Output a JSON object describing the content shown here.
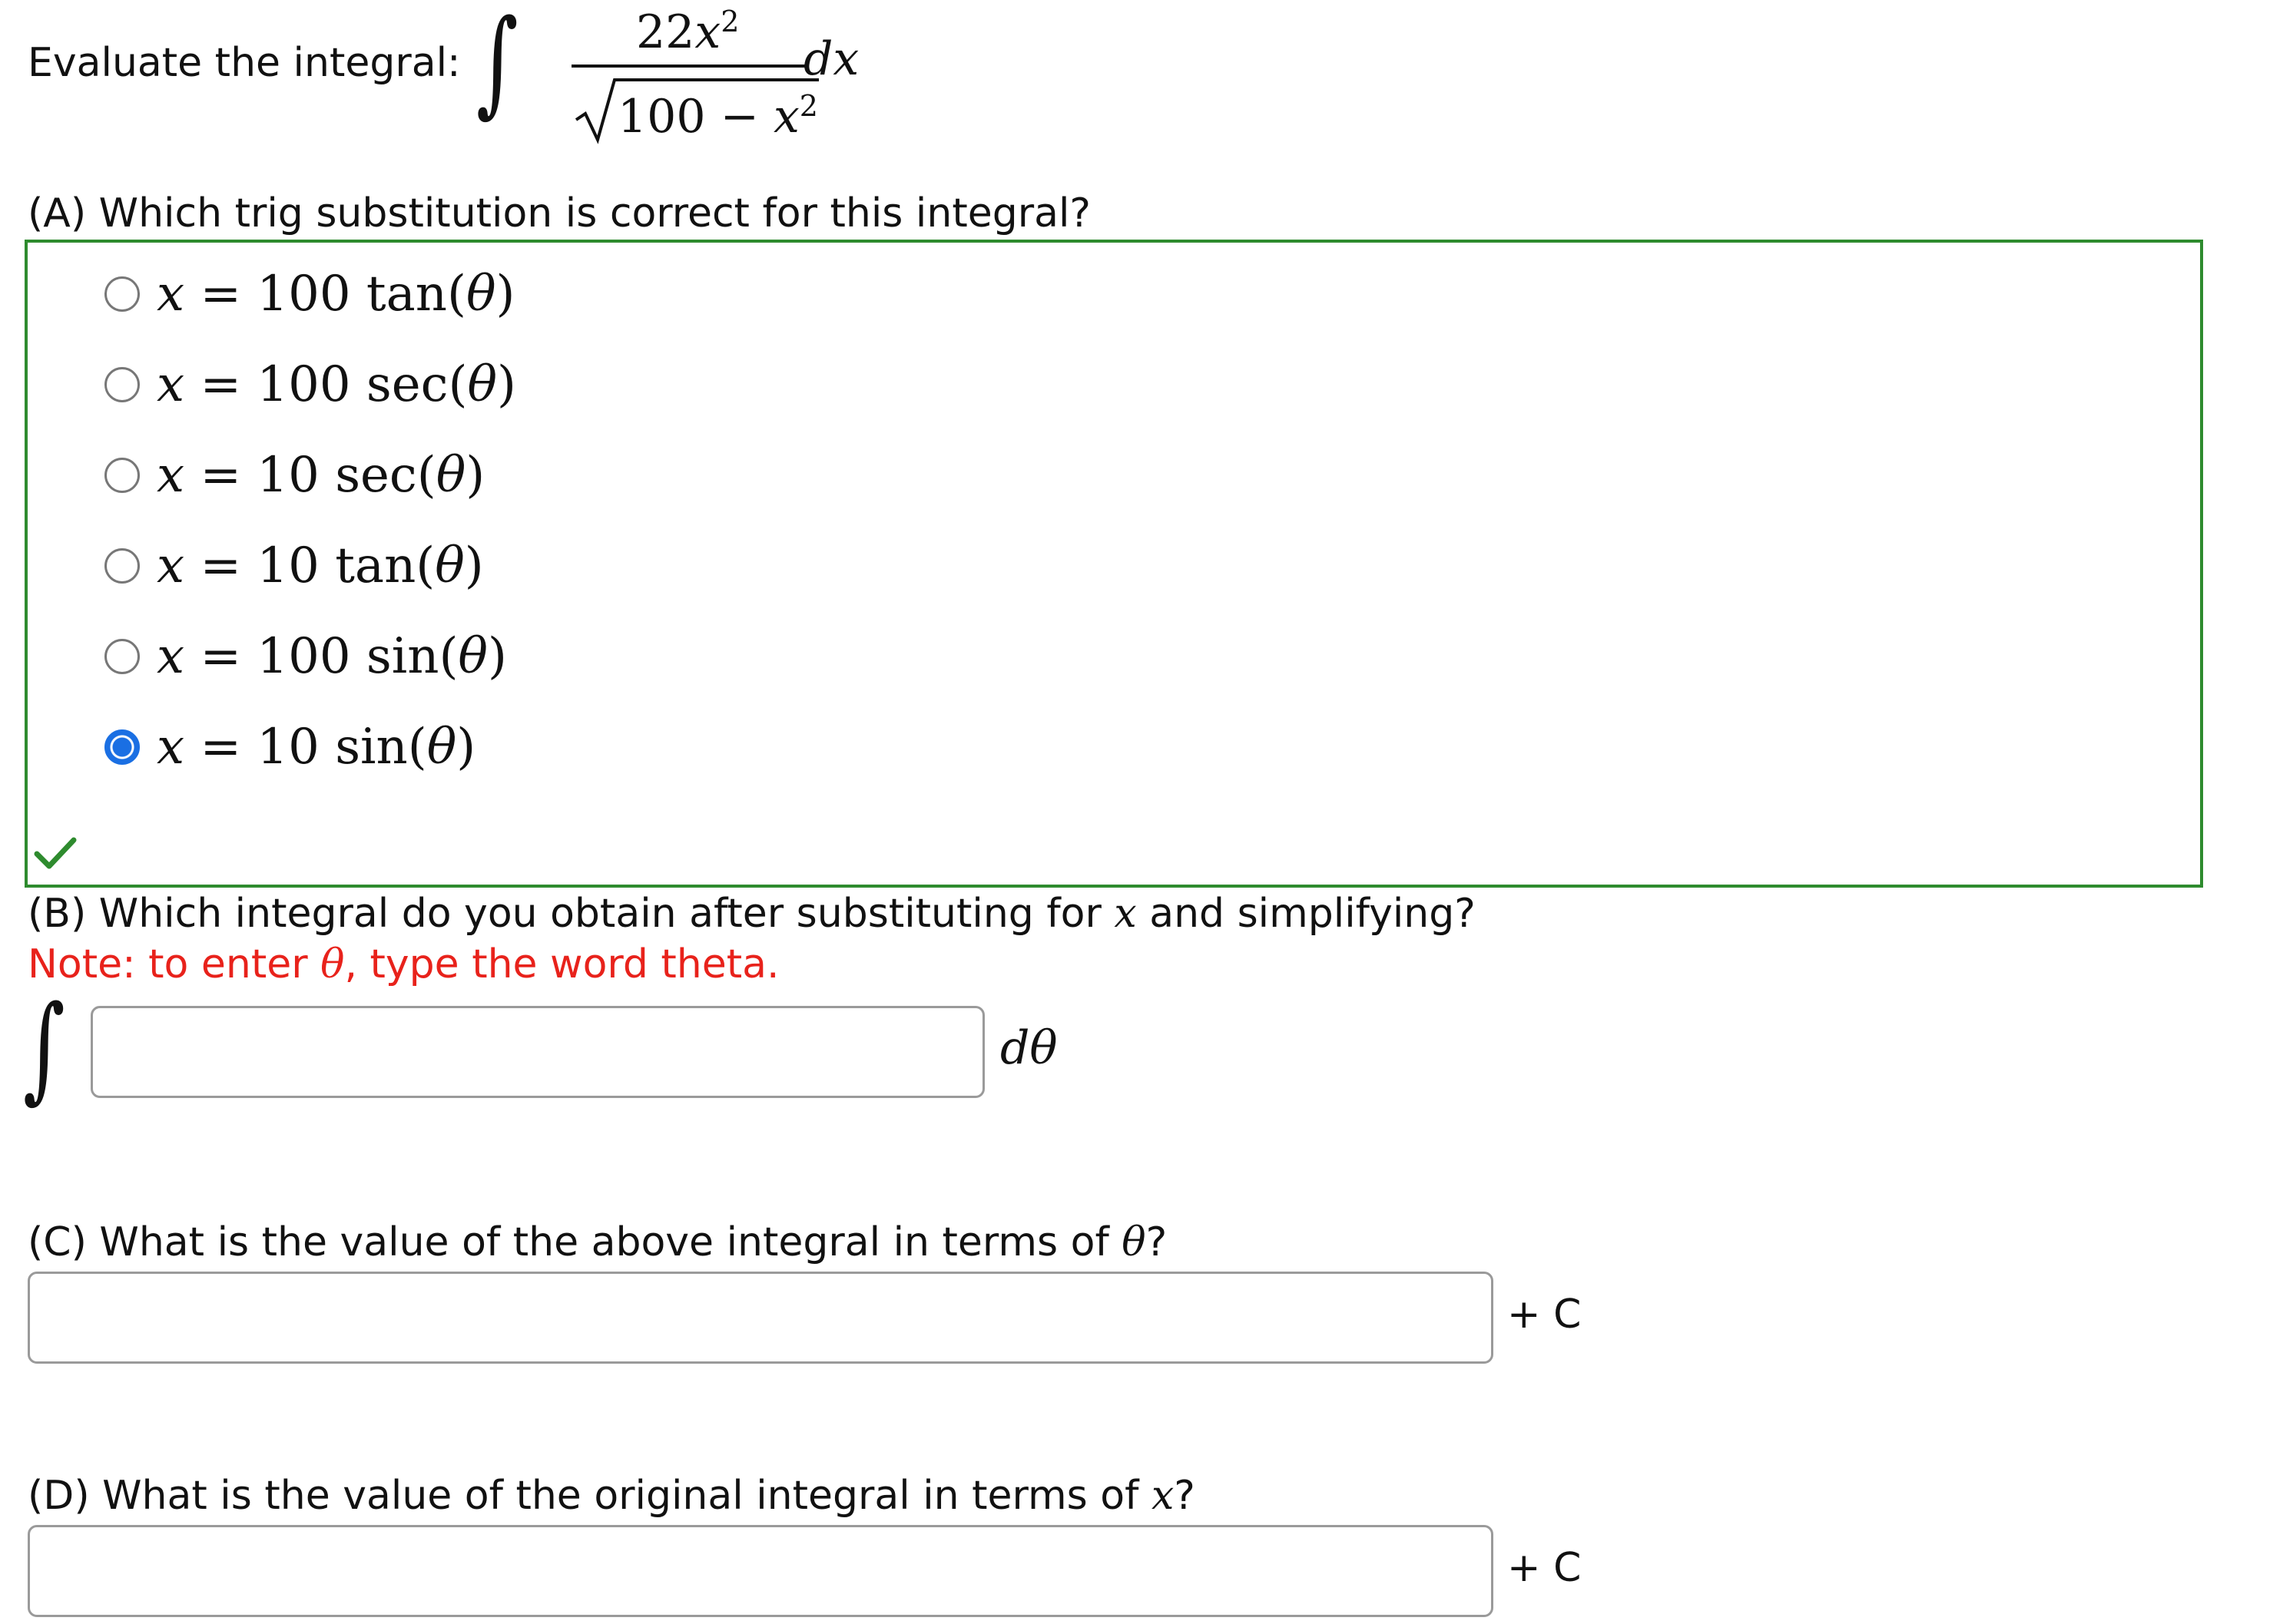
{
  "header": {
    "prompt": "Evaluate the integral:",
    "integral_symbol": "∫",
    "numerator_coeff": "22",
    "numerator_var": "x",
    "numerator_exp": "2",
    "denominator_const": "100 − ",
    "denominator_var": "x",
    "denominator_exp": "2",
    "differential": "dx"
  },
  "partA": {
    "label": "(A) Which trig substitution is correct for this integral?",
    "options": [
      {
        "var": "x",
        "eq": " = ",
        "expr": "100 tan(",
        "theta": "θ",
        "close": ")",
        "selected": false
      },
      {
        "var": "x",
        "eq": " = ",
        "expr": "100 sec(",
        "theta": "θ",
        "close": ")",
        "selected": false
      },
      {
        "var": "x",
        "eq": " = ",
        "expr": "10 sec(",
        "theta": "θ",
        "close": ")",
        "selected": false
      },
      {
        "var": "x",
        "eq": " = ",
        "expr": "10 tan(",
        "theta": "θ",
        "close": ")",
        "selected": false
      },
      {
        "var": "x",
        "eq": " = ",
        "expr": "100 sin(",
        "theta": "θ",
        "close": ")",
        "selected": false
      },
      {
        "var": "x",
        "eq": " = ",
        "expr": "10 sin(",
        "theta": "θ",
        "close": ")",
        "selected": true
      }
    ],
    "status_icon": "checkmark-icon",
    "status_color": "#2e8b2e"
  },
  "partB": {
    "label_pre": "(B) Which integral do you obtain after substituting for ",
    "label_var": "x",
    "label_post": " and simplifying?",
    "note_pre": "Note: to enter ",
    "note_theta": "θ",
    "note_post": ", type the word theta.",
    "note_color": "#e8221b",
    "integral_symbol": "∫",
    "answer_value": "",
    "differential": "dθ"
  },
  "partC": {
    "label_pre": "(C) What is the value of the above integral in terms of ",
    "label_var": "θ",
    "label_post": "?",
    "answer_value": "",
    "suffix": "+ C"
  },
  "partD": {
    "label_pre": "(D) What is the value of the original integral in terms of ",
    "label_var": "x",
    "label_post": "?",
    "answer_value": "",
    "suffix": "+ C"
  }
}
